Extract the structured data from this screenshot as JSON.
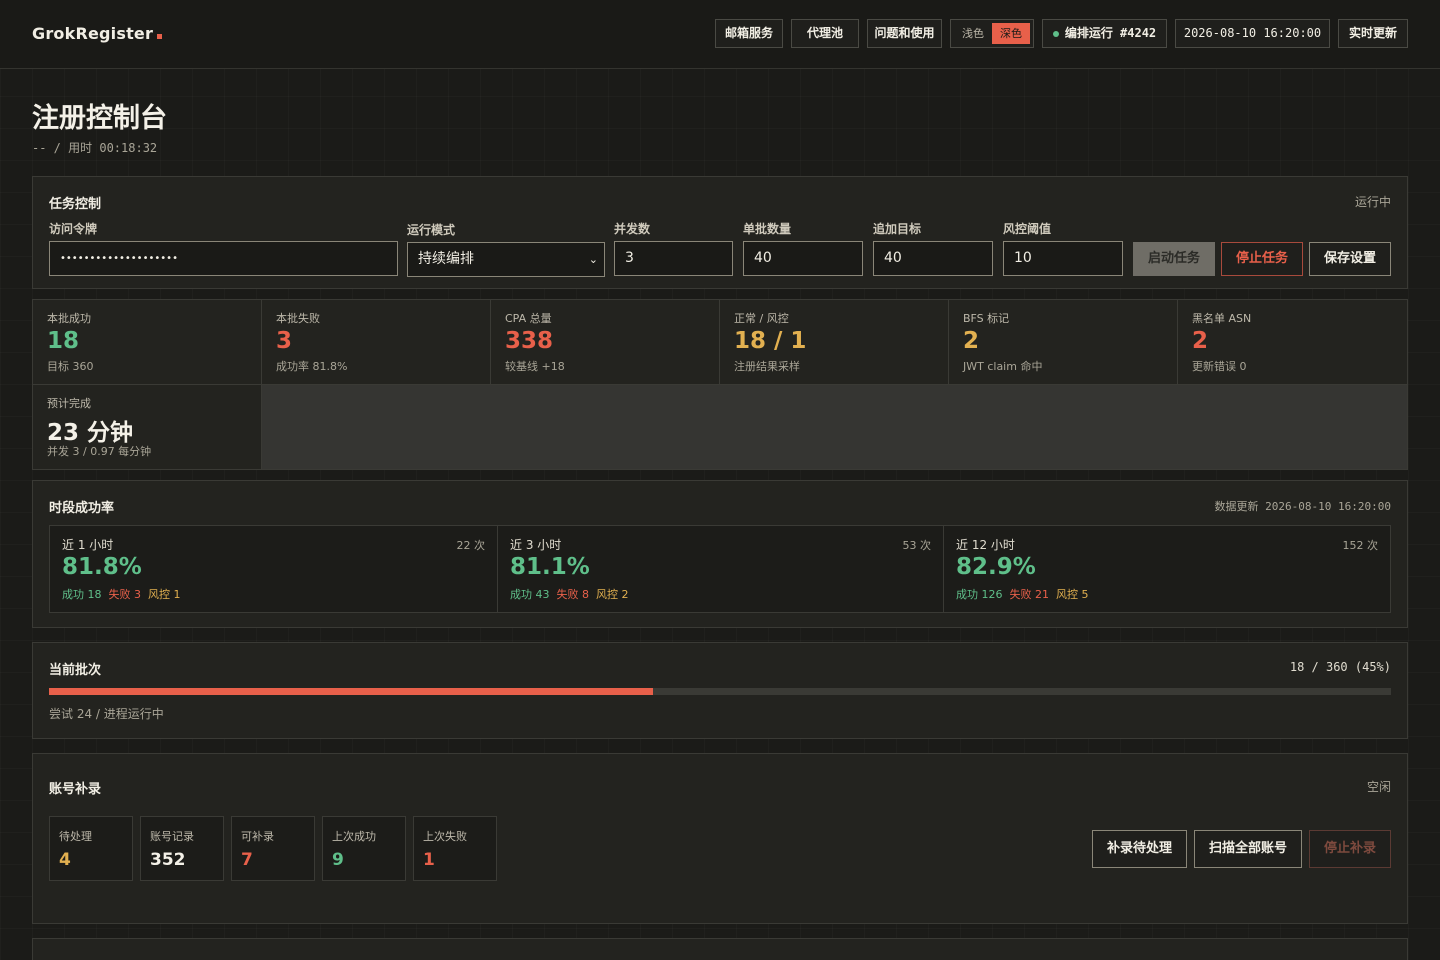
{
  "app": {
    "brand": "GrokRegister"
  },
  "topbar": {
    "mail_service": "邮箱服务",
    "proxy_pool": "代理池",
    "help": "问题和使用",
    "theme_light": "浅色",
    "theme_dark": "深色",
    "run_label": "编排运行 #4242",
    "datetime": "2026-08-10 16:20:00",
    "live_update": "实时更新"
  },
  "page": {
    "title": "注册控制台",
    "subtitle_prefix": "-- / 用时 ",
    "elapsed": "00:18:32"
  },
  "task_control": {
    "title": "任务控制",
    "status": "运行中",
    "token_label": "访问令牌",
    "token_value": "••••••••••••••••••••",
    "mode_label": "运行模式",
    "mode_value": "持续编排",
    "concurrency_label": "并发数",
    "concurrency_value": "3",
    "batch_size_label": "单批数量",
    "batch_size_value": "40",
    "extra_target_label": "追加目标",
    "extra_target_value": "40",
    "risk_threshold_label": "风控阈值",
    "risk_threshold_value": "10",
    "start_button": "启动任务",
    "stop_button": "停止任务",
    "save_button": "保存设置"
  },
  "stats": [
    {
      "label": "本批成功",
      "value": "18",
      "note": "目标 360",
      "color": "green"
    },
    {
      "label": "本批失败",
      "value": "3",
      "note": "成功率 81.8%",
      "color": "red"
    },
    {
      "label": "CPA 总量",
      "value": "338",
      "note": "较基线 +18",
      "color": "red"
    },
    {
      "label": "正常 / 风控",
      "value": "18 / 1",
      "note": "注册结果采样",
      "color": "yellow"
    },
    {
      "label": "BFS 标记",
      "value": "2",
      "note": "JWT claim 命中",
      "color": "yellow"
    },
    {
      "label": "黑名单 ASN",
      "value": "2",
      "note": "更新错误 0",
      "color": "red"
    },
    {
      "label": "预计完成",
      "value": "23 分钟",
      "note": "并发 3 / 0.97 每分钟",
      "color": "white"
    }
  ],
  "rates": {
    "title": "时段成功率",
    "updated": "数据更新 2026-08-10 16:20:00",
    "items": [
      {
        "title": "近 1 小时",
        "count": "22 次",
        "value": "81.8%",
        "success": "成功 18",
        "fail": "失败 3",
        "risk": "风控 1"
      },
      {
        "title": "近 3 小时",
        "count": "53 次",
        "value": "81.1%",
        "success": "成功 43",
        "fail": "失败 8",
        "risk": "风控 2"
      },
      {
        "title": "近 12 小时",
        "count": "152 次",
        "value": "82.9%",
        "success": "成功 126",
        "fail": "失败 21",
        "risk": "风控 5"
      }
    ]
  },
  "batch": {
    "title": "当前批次",
    "progress_text": "18 / 360 (45%)",
    "progress_fraction": 0.45,
    "note": "尝试 24 / 进程运行中"
  },
  "backfill": {
    "title": "账号补录",
    "status": "空闲",
    "cards": [
      {
        "label": "待处理",
        "value": "4",
        "color": "yellow"
      },
      {
        "label": "账号记录",
        "value": "352",
        "color": "white"
      },
      {
        "label": "可补录",
        "value": "7",
        "color": "red"
      },
      {
        "label": "上次成功",
        "value": "9",
        "color": "green"
      },
      {
        "label": "上次失败",
        "value": "1",
        "color": "red"
      }
    ],
    "backfill_pending_button": "补录待处理",
    "scan_all_button": "扫描全部账号",
    "stop_backfill_button": "停止补录"
  }
}
